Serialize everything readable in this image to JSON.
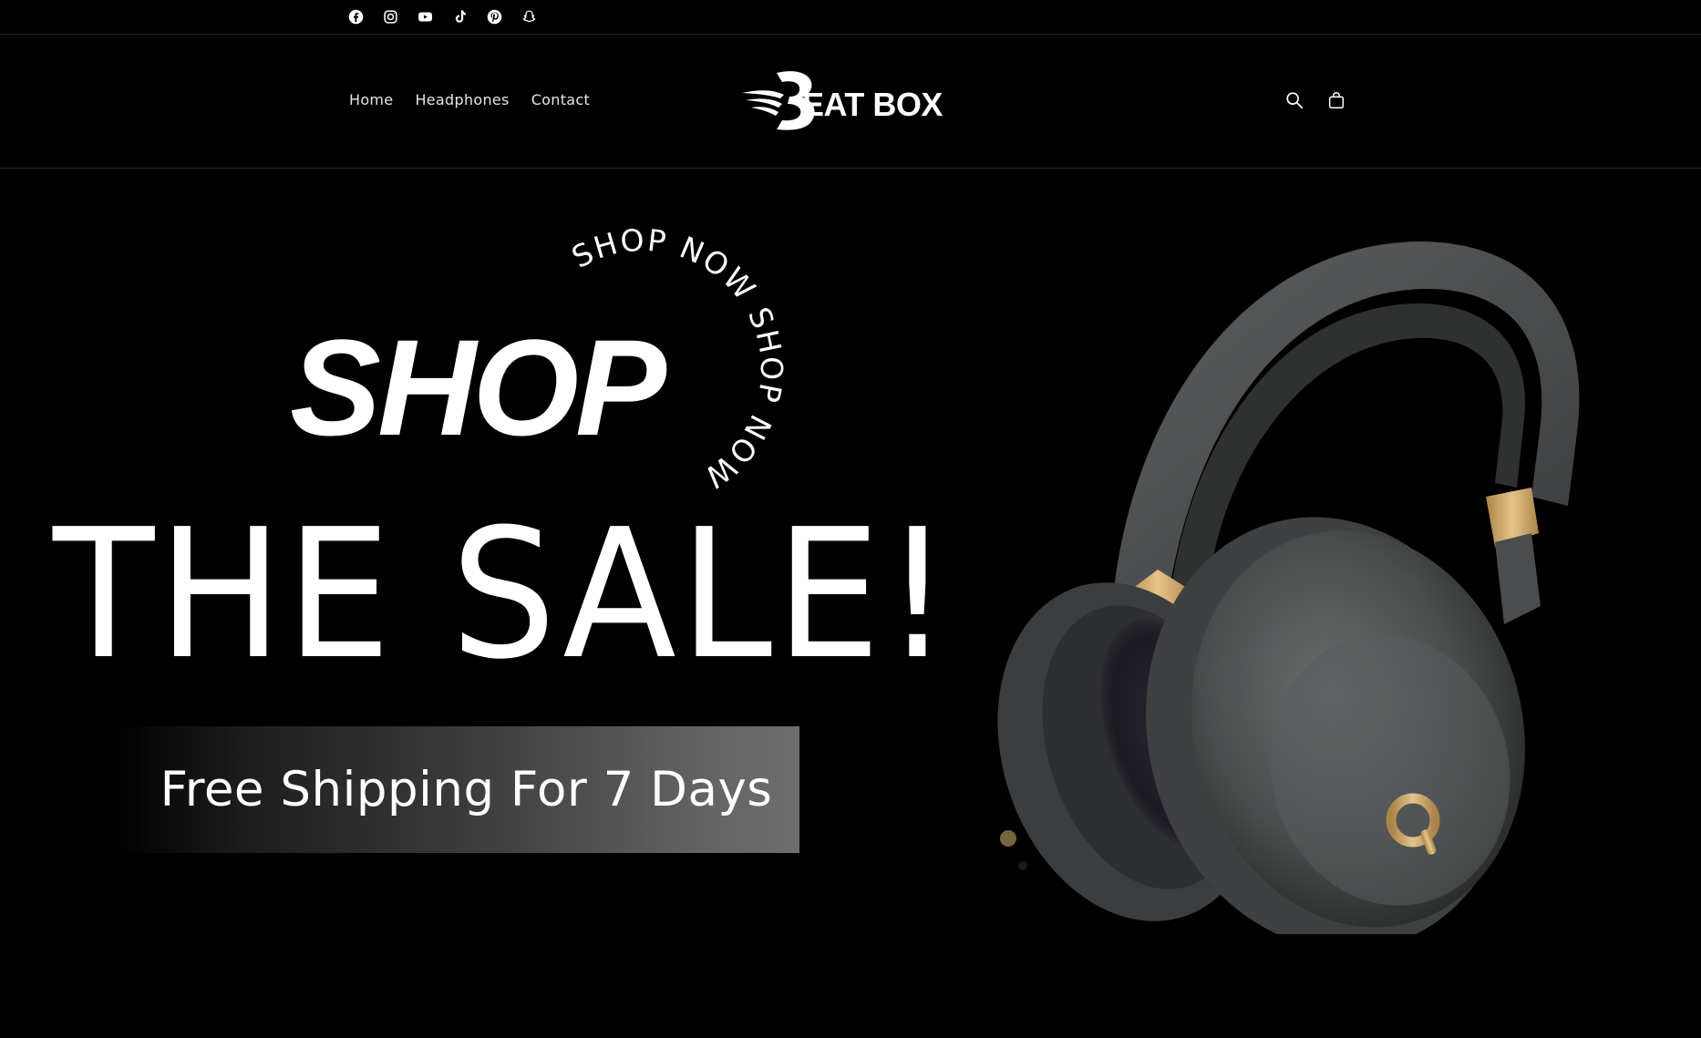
{
  "social": {
    "icons": [
      "facebook-icon",
      "instagram-icon",
      "youtube-icon",
      "tiktok-icon",
      "pinterest-icon",
      "snapchat-icon"
    ]
  },
  "header": {
    "nav": [
      {
        "label": "Home"
      },
      {
        "label": "Headphones"
      },
      {
        "label": "Contact"
      }
    ],
    "logo_text": "EAT BOX",
    "logo_letter": "B",
    "actions": [
      "search-icon",
      "cart-icon"
    ]
  },
  "hero": {
    "title": "SHOP",
    "circle_text": "SHOP NOW SHOP NOW",
    "subtitle": "THE SALE!",
    "shipping_banner": "Free Shipping For 7 Days",
    "product_image": "grey over-ear headphones with gold accents"
  },
  "colors": {
    "background": "#000000",
    "text": "#ffffff",
    "accent_gold": "#c9a461",
    "headphone_grey": "#4a4c4d"
  }
}
